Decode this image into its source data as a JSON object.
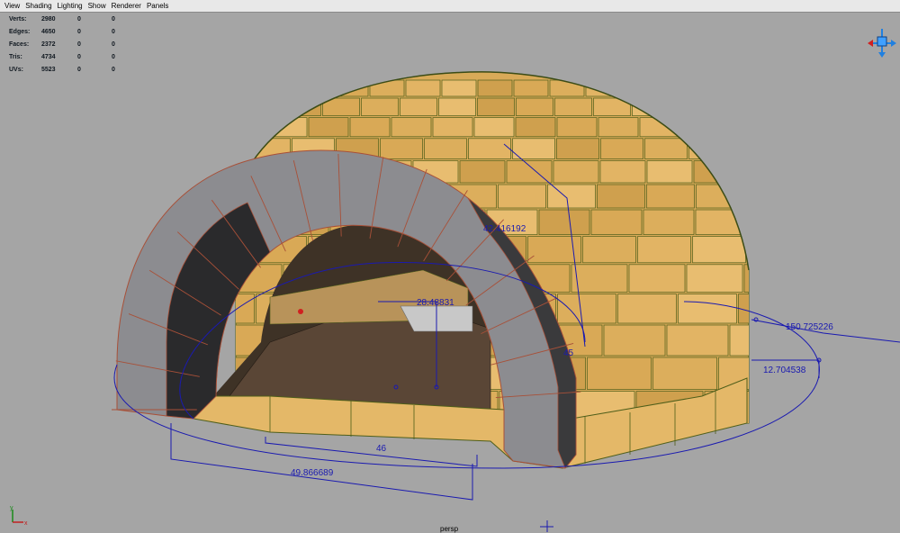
{
  "menubar": {
    "items": [
      "View",
      "Shading",
      "Lighting",
      "Show",
      "Renderer",
      "Panels"
    ]
  },
  "hud": {
    "rows": [
      {
        "label": "Verts:",
        "value": "2980",
        "sel": "0",
        "comp": "0"
      },
      {
        "label": "Edges:",
        "value": "4650",
        "sel": "0",
        "comp": "0"
      },
      {
        "label": "Faces:",
        "value": "2372",
        "sel": "0",
        "comp": "0"
      },
      {
        "label": "Tris:",
        "value": "4734",
        "sel": "0",
        "comp": "0"
      },
      {
        "label": "UVs:",
        "value": "5523",
        "sel": "0",
        "comp": "0"
      }
    ]
  },
  "measurements": {
    "arch_outer_radius": "42.416192",
    "arch_inner_height": "28.48831",
    "arch_depth": "45",
    "dome_radius": "150.725226",
    "ring_offset": "12.704538",
    "base_width": "46",
    "base_span": "49.866689"
  },
  "viewport": {
    "camera": "persp",
    "axis_x": "x",
    "axis_y": "y"
  },
  "colors": {
    "viewport_bg": "#a5a5a5",
    "brick": "#e0b462",
    "brick_edge": "#5a6a1e",
    "arch_stone": "#8a8a8e",
    "arch_edge": "#b0503a",
    "measure": "#1a1ab0"
  }
}
